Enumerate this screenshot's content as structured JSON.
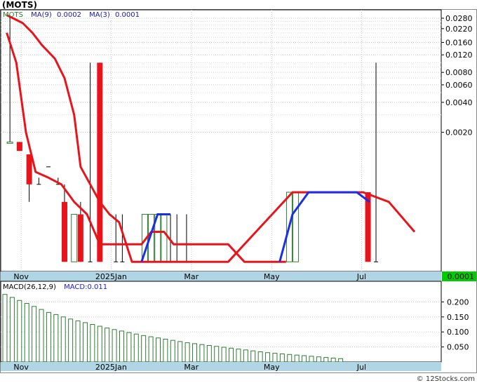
{
  "title": "(MOTS)",
  "legend": {
    "symbol": "MOTS",
    "ma9": "MA(9)",
    "ma9_value": "0.0002",
    "ma3": "MA(3)",
    "ma3_value": "0.0001",
    "macd_label": "MACD(26,12,9)",
    "macd_value": "MACD:0.011"
  },
  "last_price": "0.0001",
  "watermark": "© 12Stocks.com",
  "colors": {
    "background": "#ffffff",
    "axis_strip": "#b0d6e6",
    "grid": "#c8c8c8",
    "up_bar": "#2e7d32",
    "down_bar": "#e8141c",
    "ma9_line": "#e8141c",
    "ma3_line": "#1a2fe6",
    "macd_bar": "#2e7d32",
    "last_price_box": "#00cc00",
    "legend_symbol": "#2e7d32",
    "legend_ma9": "#1a1aa8",
    "legend_ma3": "#1a1aa8",
    "macd_value_color": "#1a1ae6"
  },
  "chart_data": [
    {
      "type": "candlestick",
      "y_scale": "log",
      "y_ticks": [
        "0.0280",
        "0.0220",
        "0.0160",
        "0.0120",
        "0.0080",
        "0.0060",
        "0.0040",
        "0.0020",
        "0.0001"
      ],
      "x_ticks": [
        "Nov",
        "2025Jan",
        "Mar",
        "May",
        "Jul"
      ],
      "candles": [
        {
          "x": 0.02,
          "open": 0.0016,
          "close": 0.0016,
          "high": 0.03,
          "low": 0.0016,
          "color": "up"
        },
        {
          "x": 0.05,
          "open": 0.0016,
          "close": 0.0013,
          "high": 0.0016,
          "low": 0.0013,
          "color": "down"
        },
        {
          "x": 0.08,
          "open": 0.0012,
          "close": 0.0006,
          "high": 0.0012,
          "low": 0.0004,
          "color": "down"
        },
        {
          "x": 0.11,
          "open": 0.0006,
          "close": 0.0006,
          "high": 0.0007,
          "low": 0.0006,
          "color": "flat"
        },
        {
          "x": 0.14,
          "open": 0.0009,
          "close": 0.0009,
          "high": 0.0009,
          "low": 0.0009,
          "color": "flat"
        },
        {
          "x": 0.17,
          "open": 0.0006,
          "close": 0.0006,
          "high": 0.0007,
          "low": 0.0006,
          "color": "flat"
        },
        {
          "x": 0.19,
          "open": 0.0004,
          "close": 0.0001,
          "high": 0.0006,
          "low": 0.0001,
          "color": "down"
        },
        {
          "x": 0.22,
          "open": 0.0003,
          "close": 0.0001,
          "high": 0.0003,
          "low": 0.0001,
          "color": "up"
        },
        {
          "x": 0.24,
          "open": 0.0003,
          "close": 0.0001,
          "high": 0.0004,
          "low": 0.0001,
          "color": "down"
        },
        {
          "x": 0.27,
          "open": 0.0001,
          "close": 0.0001,
          "high": 0.01,
          "low": 0.0001,
          "color": "flat"
        },
        {
          "x": 0.3,
          "open": 0.01,
          "close": 0.0001,
          "high": 0.01,
          "low": 0.0001,
          "color": "down"
        },
        {
          "x": 0.35,
          "open": 0.0001,
          "close": 0.0001,
          "high": 0.0003,
          "low": 0.0001,
          "color": "flat"
        },
        {
          "x": 0.37,
          "open": 0.0001,
          "close": 0.0001,
          "high": 0.0003,
          "low": 0.0001,
          "color": "flat"
        },
        {
          "x": 0.44,
          "open": 0.0001,
          "close": 0.0003,
          "high": 0.0003,
          "low": 0.0001,
          "color": "up"
        },
        {
          "x": 0.46,
          "open": 0.0001,
          "close": 0.0003,
          "high": 0.0003,
          "low": 0.0001,
          "color": "up"
        },
        {
          "x": 0.48,
          "open": 0.0001,
          "close": 0.0003,
          "high": 0.0003,
          "low": 0.0001,
          "color": "up"
        },
        {
          "x": 0.5,
          "open": 0.0001,
          "close": 0.0003,
          "high": 0.0003,
          "low": 0.0001,
          "color": "up"
        },
        {
          "x": 0.52,
          "open": 0.0001,
          "close": 0.0001,
          "high": 0.0003,
          "low": 0.0001,
          "color": "flat"
        },
        {
          "x": 0.54,
          "open": 0.0001,
          "close": 0.0001,
          "high": 0.0003,
          "low": 0.0001,
          "color": "flat"
        },
        {
          "x": 0.57,
          "open": 0.0001,
          "close": 0.0001,
          "high": 0.0003,
          "low": 0.0001,
          "color": "flat"
        },
        {
          "x": 0.89,
          "open": 0.0001,
          "close": 0.0005,
          "high": 0.0005,
          "low": 0.0001,
          "color": "up"
        },
        {
          "x": 0.91,
          "open": 0.0001,
          "close": 0.0005,
          "high": 0.0005,
          "low": 0.0001,
          "color": "up"
        },
        {
          "x": 0.93,
          "open": 0.0005,
          "close": 0.0005,
          "high": 0.0005,
          "low": 0.0005,
          "color": "flat"
        },
        {
          "x": 0.95,
          "open": 0.0005,
          "close": 0.0005,
          "high": 0.0005,
          "low": 0.0005,
          "color": "flat"
        },
        {
          "x": 1.135,
          "open": 0.0005,
          "close": 0.0001,
          "high": 0.0005,
          "low": 0.0001,
          "color": "down"
        },
        {
          "x": 1.16,
          "open": 0.0001,
          "close": 0.0001,
          "high": 0.01,
          "low": 0.0001,
          "color": "flat"
        }
      ],
      "ma9": [
        {
          "x": 0.01,
          "y": 0.03
        },
        {
          "x": 0.03,
          "y": 0.028
        },
        {
          "x": 0.06,
          "y": 0.025
        },
        {
          "x": 0.09,
          "y": 0.02
        },
        {
          "x": 0.12,
          "y": 0.015
        },
        {
          "x": 0.16,
          "y": 0.011
        },
        {
          "x": 0.19,
          "y": 0.007
        },
        {
          "x": 0.22,
          "y": 0.003
        },
        {
          "x": 0.24,
          "y": 0.0009
        },
        {
          "x": 0.27,
          "y": 0.0006
        },
        {
          "x": 0.3,
          "y": 0.0004
        },
        {
          "x": 0.33,
          "y": 0.0003
        },
        {
          "x": 0.36,
          "y": 0.00025
        },
        {
          "x": 0.4,
          "y": 0.0001
        },
        {
          "x": 0.7,
          "y": 0.0001
        },
        {
          "x": 0.9,
          "y": 0.0005
        },
        {
          "x": 1.12,
          "y": 0.0005
        },
        {
          "x": 1.2,
          "y": 0.0004
        },
        {
          "x": 1.28,
          "y": 0.0002
        }
      ],
      "ma9_short": [
        {
          "x": 0.01,
          "y": 0.02
        },
        {
          "x": 0.04,
          "y": 0.01
        },
        {
          "x": 0.07,
          "y": 0.002
        },
        {
          "x": 0.1,
          "y": 0.0008
        },
        {
          "x": 0.14,
          "y": 0.0007
        },
        {
          "x": 0.18,
          "y": 0.0006
        },
        {
          "x": 0.22,
          "y": 0.0004
        },
        {
          "x": 0.26,
          "y": 0.0003
        },
        {
          "x": 0.3,
          "y": 0.00015
        },
        {
          "x": 0.43,
          "y": 0.00015
        },
        {
          "x": 0.46,
          "y": 0.0002
        },
        {
          "x": 0.5,
          "y": 0.0002
        },
        {
          "x": 0.53,
          "y": 0.00015
        },
        {
          "x": 0.7,
          "y": 0.00015
        },
        {
          "x": 0.75,
          "y": 0.0001
        },
        {
          "x": 0.88,
          "y": 0.0001
        }
      ],
      "ma3": [
        {
          "x": 0.43,
          "y": 0.0001
        },
        {
          "x": 0.48,
          "y": 0.0003
        },
        {
          "x": 0.52,
          "y": 0.0003
        },
        {
          "x": 0.86,
          "y": 0.0001
        },
        {
          "x": 0.9,
          "y": 0.0003
        },
        {
          "x": 0.95,
          "y": 0.0005
        },
        {
          "x": 1.1,
          "y": 0.0005
        },
        {
          "x": 1.14,
          "y": 0.0004
        }
      ]
    },
    {
      "type": "bar",
      "title": "MACD(26,12,9)",
      "y_ticks": [
        "0.200",
        "0.150",
        "0.100",
        "0.050"
      ],
      "x_ticks": [
        "Nov",
        "2025Jan",
        "Mar",
        "May",
        "Jul"
      ],
      "values": [
        0.225,
        0.215,
        0.205,
        0.195,
        0.185,
        0.175,
        0.165,
        0.158,
        0.15,
        0.143,
        0.137,
        0.131,
        0.125,
        0.119,
        0.113,
        0.108,
        0.103,
        0.098,
        0.093,
        0.088,
        0.084,
        0.08,
        0.076,
        0.072,
        0.068,
        0.064,
        0.061,
        0.058,
        0.055,
        0.052,
        0.049,
        0.046,
        0.043,
        0.04,
        0.037,
        0.034,
        0.031,
        0.029,
        0.027,
        0.025,
        0.023,
        0.021,
        0.019,
        0.017,
        0.015,
        0.013,
        0.011
      ],
      "ylim": [
        0,
        0.25
      ]
    }
  ]
}
